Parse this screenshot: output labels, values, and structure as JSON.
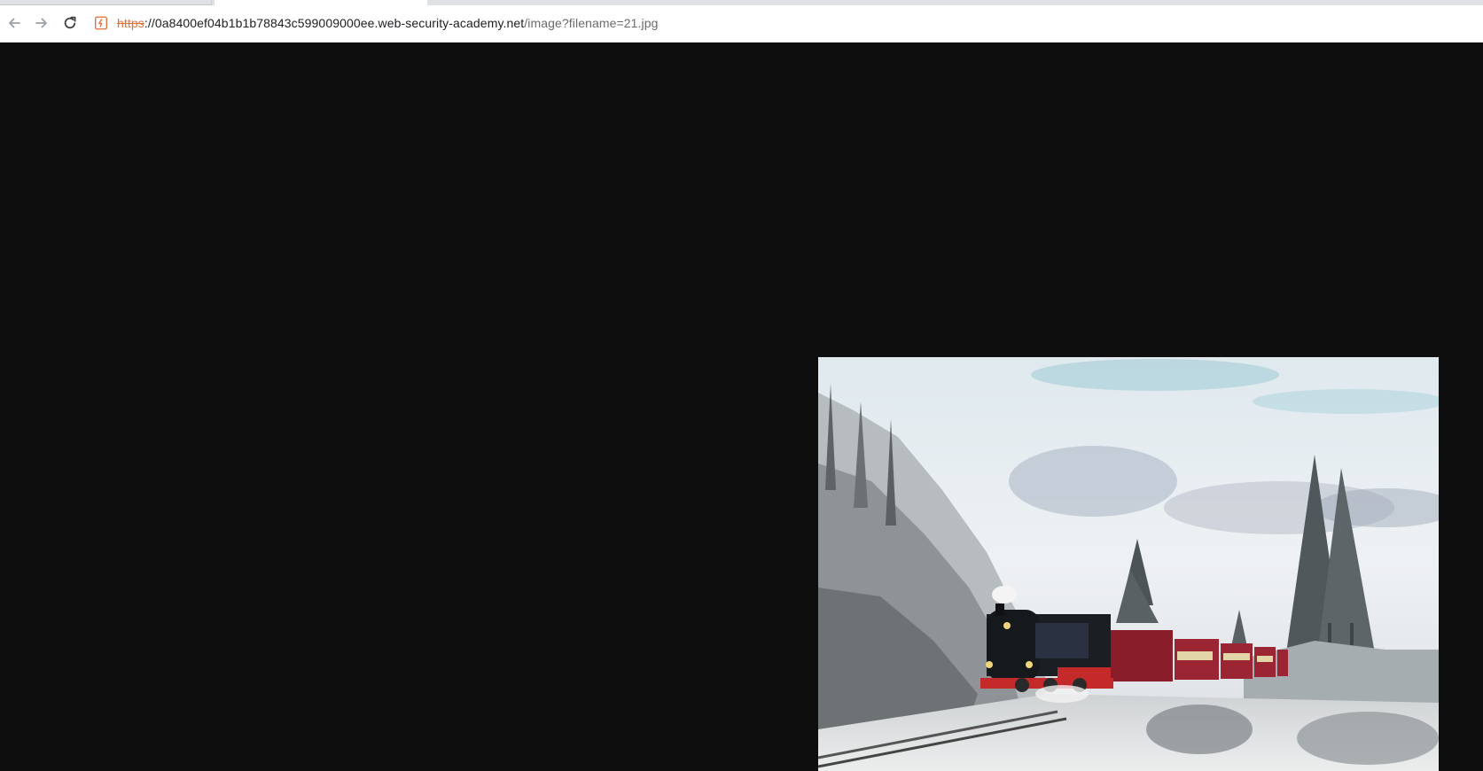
{
  "browser": {
    "back_icon": "arrow-left-icon",
    "forward_icon": "arrow-right-icon",
    "reload_icon": "reload-icon",
    "security_icon": "not-secure-icon",
    "url": {
      "scheme": "https",
      "separator": "://",
      "host": "0a8400ef04b1b1b78843c599009000ee.web-security-academy.net",
      "path": "/image?filename=21.jpg"
    }
  },
  "content": {
    "image_subject": "steam-train-image",
    "background_color": "#0e0e0f"
  }
}
